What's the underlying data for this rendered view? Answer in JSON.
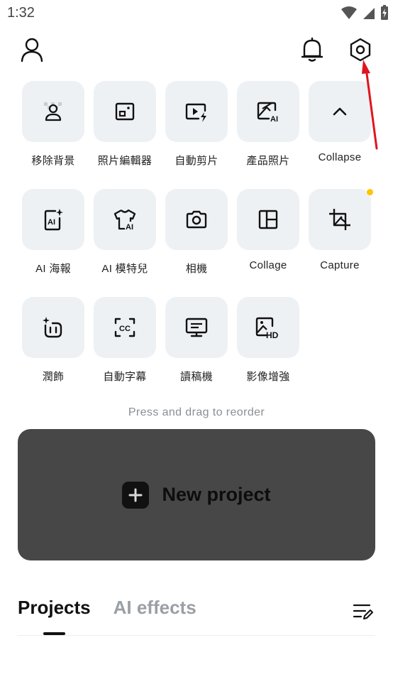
{
  "status_bar": {
    "time": "1:32"
  },
  "tools": [
    {
      "label": "移除背景",
      "icon": "remove-background-icon"
    },
    {
      "label": "照片編輯器",
      "icon": "photo-editor-icon"
    },
    {
      "label": "自動剪片",
      "icon": "auto-cut-icon"
    },
    {
      "label": "產品照片",
      "icon": "ai-product-photo-icon"
    },
    {
      "label": "Collapse",
      "icon": "chevron-up-icon"
    },
    {
      "label": "AI 海報",
      "icon": "ai-poster-icon"
    },
    {
      "label": "AI 模特兒",
      "icon": "ai-model-shirt-icon"
    },
    {
      "label": "相機",
      "icon": "camera-icon"
    },
    {
      "label": "Collage",
      "icon": "collage-icon"
    },
    {
      "label": "Capture",
      "icon": "capture-crop-icon"
    },
    {
      "label": "潤飾",
      "icon": "retouch-icon"
    },
    {
      "label": "自動字幕",
      "icon": "auto-captions-icon"
    },
    {
      "label": "讀稿機",
      "icon": "teleprompter-icon"
    },
    {
      "label": "影像增強",
      "icon": "hd-enhance-icon"
    }
  ],
  "reorder_hint": "Press and drag to reorder",
  "new_project": {
    "label": "New project"
  },
  "tabs": [
    {
      "label": "Projects",
      "active": true
    },
    {
      "label": "AI effects",
      "active": false
    }
  ],
  "colors": {
    "tile_bg": "#eef1f4",
    "new_project_bg": "#474747",
    "badge": "#ffc400",
    "annotation_arrow": "#e0141e"
  }
}
